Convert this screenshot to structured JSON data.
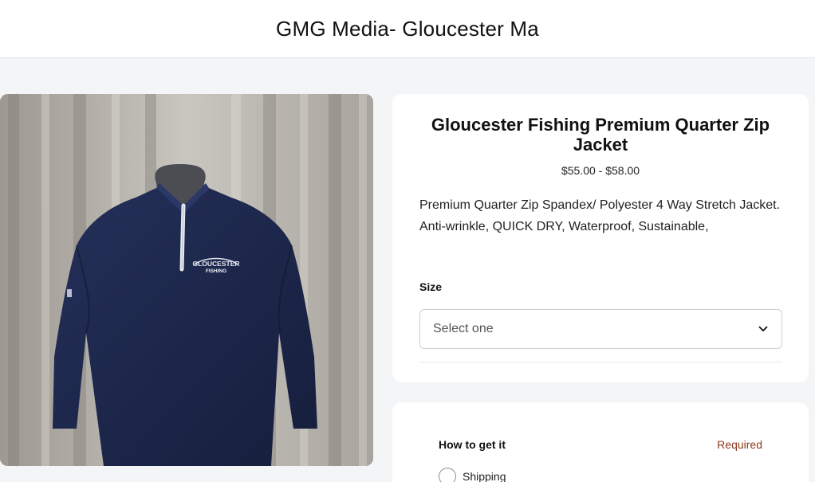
{
  "header": {
    "site_title": "GMG Media- Gloucester Ma"
  },
  "product": {
    "title": "Gloucester Fishing Premium Quarter Zip Jacket",
    "price_range": "$55.00 - $58.00",
    "description_line1": "Premium Quarter Zip Spandex/ Polyester 4 Way Stretch Jacket.",
    "description_line2": "Anti-wrinkle, QUICK DRY, Waterproof, Sustainable,",
    "image_logo_text_line1": "GLOUCESTER",
    "image_logo_text_line2": "FISHING"
  },
  "size": {
    "label": "Size",
    "placeholder": "Select one"
  },
  "fulfillment": {
    "label": "How to get it",
    "required_text": "Required",
    "options": [
      {
        "label": "Shipping"
      }
    ]
  },
  "icons": {
    "select_chevron": "chevron-down-icon"
  },
  "colors": {
    "required_accent": "#8a3a1c",
    "jacket_navy": "#1c2647"
  }
}
